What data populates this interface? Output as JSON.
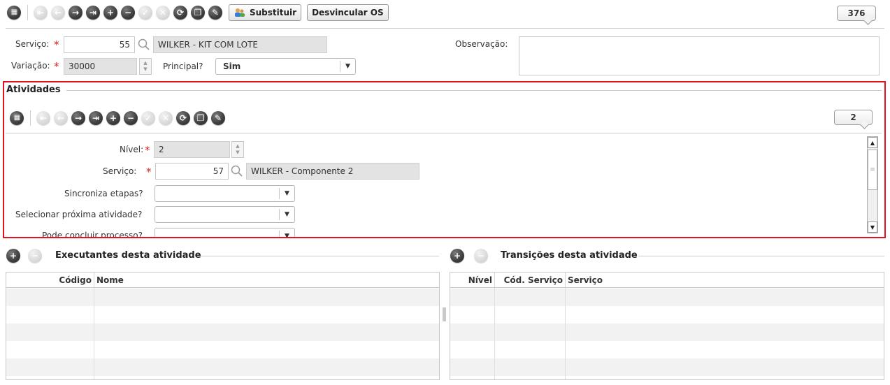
{
  "top_toolbar": {
    "substituir_label": "Substituir",
    "desvincular_label": "Desvincular OS",
    "record_count": "376"
  },
  "form": {
    "servico_label": "Serviço:",
    "servico_code": "55",
    "servico_desc": "WILKER - KIT COM LOTE",
    "variacao_label": "Variação:",
    "variacao_value": "30000",
    "principal_label": "Principal?",
    "principal_value": "Sim",
    "observacao_label": "Observação:",
    "observacao_value": ""
  },
  "atividades": {
    "title": "Atividades",
    "record_count": "2",
    "nivel_label": "Nível:",
    "nivel_value": "2",
    "servico_label": "Serviço:",
    "servico_code": "57",
    "servico_desc": "WILKER - Componente 2",
    "sincroniza_label": "Sincroniza etapas?",
    "sincroniza_value": "",
    "selecionar_label": "Selecionar próxima atividade?",
    "selecionar_value": "",
    "pode_concluir_label": "Pode concluir processo?"
  },
  "executantes": {
    "title": "Executantes desta atividade",
    "columns": [
      "Código",
      "Nome"
    ]
  },
  "transicoes": {
    "title": "Transições desta atividade",
    "columns": [
      "Nível",
      "Cód. Serviço",
      "Serviço"
    ]
  },
  "colors": {
    "highlight": "#e0141e",
    "required": "#e02020",
    "readonly_bg": "#e3e3e3"
  },
  "icons": {
    "toolbar": [
      "grid-icon",
      "first-icon",
      "prev-icon",
      "next-icon",
      "last-icon",
      "add-icon",
      "remove-icon",
      "confirm-icon",
      "cancel-icon",
      "refresh-icon",
      "duplicate-icon",
      "attach-icon"
    ]
  }
}
